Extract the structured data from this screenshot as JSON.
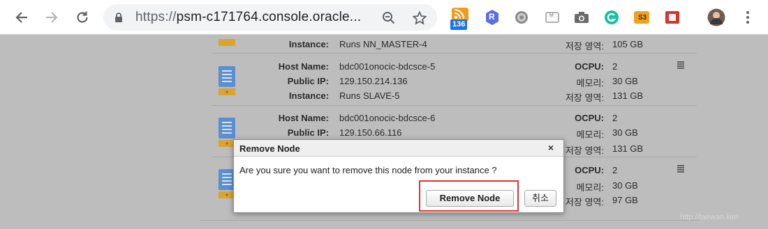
{
  "browser": {
    "url_scheme": "https://",
    "url_host": "psm-c171764.console.oracle...",
    "rss_badge": "136",
    "ext_r_label": "R",
    "ext_s3_label": "S3",
    "ext_avocode_label": "M"
  },
  "nodes": [
    {
      "instance_label": "Instance:",
      "instance_value": "Runs NN_MASTER-4",
      "storage_label": "저장 영역:",
      "storage_value": "105 GB"
    },
    {
      "host_label": "Host Name:",
      "host_value": "bdc001onocic-bdcsce-5",
      "ip_label": "Public IP:",
      "ip_value": "129.150.214.136",
      "instance_label": "Instance:",
      "instance_value": "Runs SLAVE-5",
      "ocpu_label": "OCPU:",
      "ocpu_value": "2",
      "memory_label": "메모리:",
      "memory_value": "30 GB",
      "storage_label": "저장 영역:",
      "storage_value": "131 GB"
    },
    {
      "host_label": "Host Name:",
      "host_value": "bdc001onocic-bdcsce-6",
      "ip_label": "Public IP:",
      "ip_value": "129.150.66.116",
      "ocpu_label": "OCPU:",
      "ocpu_value": "2",
      "memory_label": "메모리:",
      "memory_value": "30 GB",
      "storage_label": "저장 영역:",
      "storage_value": "131 GB"
    },
    {
      "ocpu_label": "OCPU:",
      "ocpu_value": "2",
      "memory_label": "메모리:",
      "memory_value": "30 GB",
      "storage_label": "저장 영역:",
      "storage_value": "97 GB"
    }
  ],
  "dialog": {
    "title": "Remove Node",
    "close": "×",
    "message": "Are you sure you want to remove this node from your instance ?",
    "confirm_label": "Remove Node",
    "cancel_label": "취소"
  },
  "watermark": "http://taewan.kim",
  "colors": {
    "highlight": "#e3302f",
    "server_icon": "#5b8fd0",
    "server_base": "#d9a531"
  }
}
